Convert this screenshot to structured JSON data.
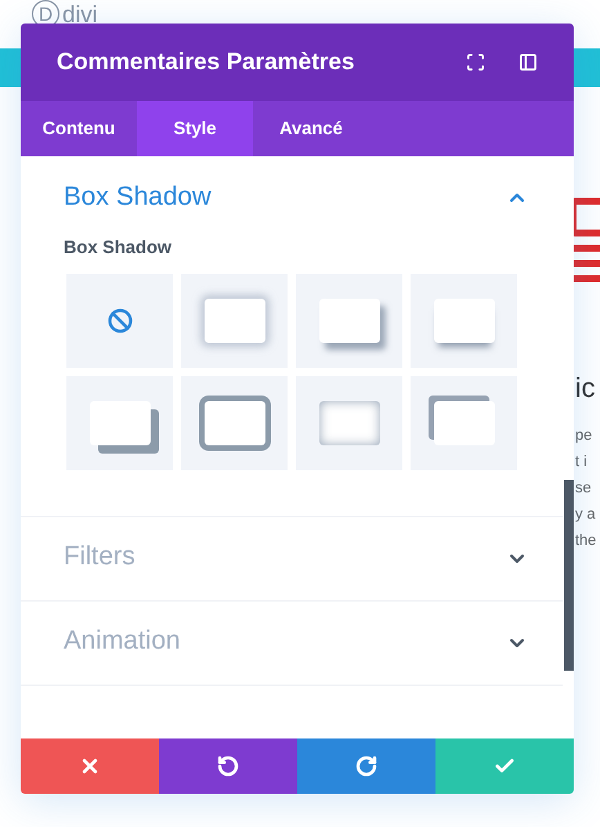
{
  "background": {
    "logo": {
      "mark": "D",
      "name": "divi"
    },
    "heading_fragment": "ic",
    "text_fragments": [
      "pe",
      "t i",
      "se",
      "y a",
      "the"
    ]
  },
  "panel": {
    "title": "Commentaires Paramètres",
    "tabs": [
      {
        "label": "Contenu",
        "selected": false
      },
      {
        "label": "Style",
        "selected": true
      },
      {
        "label": "Avancé",
        "selected": false
      }
    ],
    "sections": [
      {
        "title": "Box Shadow",
        "expanded": true,
        "field": {
          "label": "Box Shadow",
          "options": [
            {
              "kind": "none"
            },
            {
              "kind": "glow"
            },
            {
              "kind": "drop"
            },
            {
              "kind": "under"
            },
            {
              "kind": "offset"
            },
            {
              "kind": "border"
            },
            {
              "kind": "inset"
            },
            {
              "kind": "corner"
            }
          ]
        }
      },
      {
        "title": "Filters",
        "expanded": false
      },
      {
        "title": "Animation",
        "expanded": false
      }
    ],
    "footer": [
      {
        "kind": "cancel"
      },
      {
        "kind": "undo"
      },
      {
        "kind": "redo"
      },
      {
        "kind": "save"
      }
    ]
  }
}
